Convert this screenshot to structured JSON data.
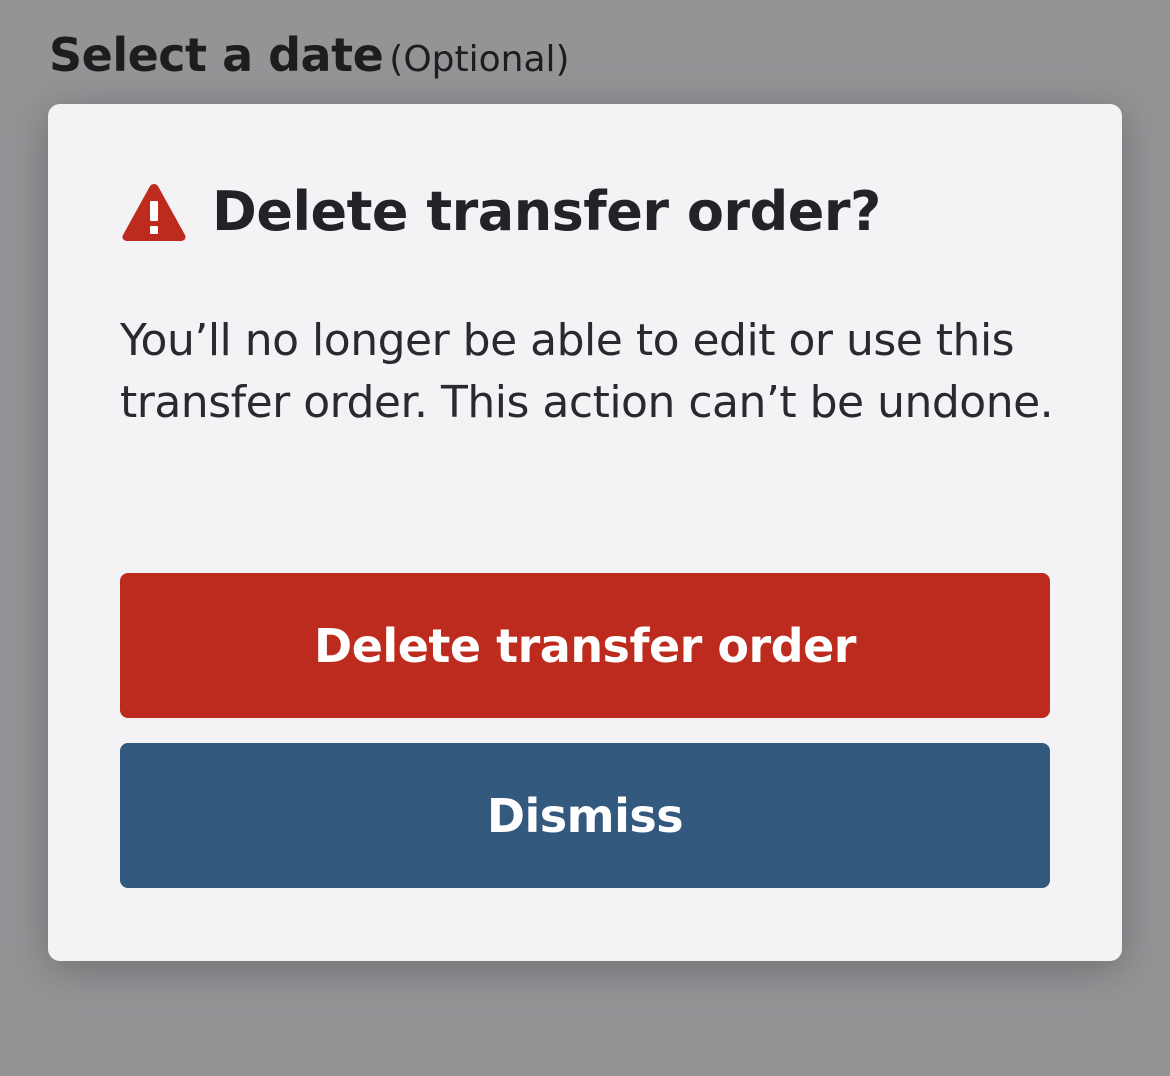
{
  "background": {
    "label_main": "Select a date",
    "label_suffix": "(Optional)"
  },
  "modal": {
    "icon": "warning-triangle-icon",
    "title": "Delete transfer order?",
    "body": "You’ll no longer be able to edit or use this transfer order. This action can’t be undone.",
    "buttons": {
      "delete_label": "Delete transfer order",
      "dismiss_label": "Dismiss"
    }
  },
  "colors": {
    "danger": "#bd2b1f",
    "primary": "#33597e",
    "modal_bg": "#f3f2f5",
    "overlay": "#949396"
  }
}
